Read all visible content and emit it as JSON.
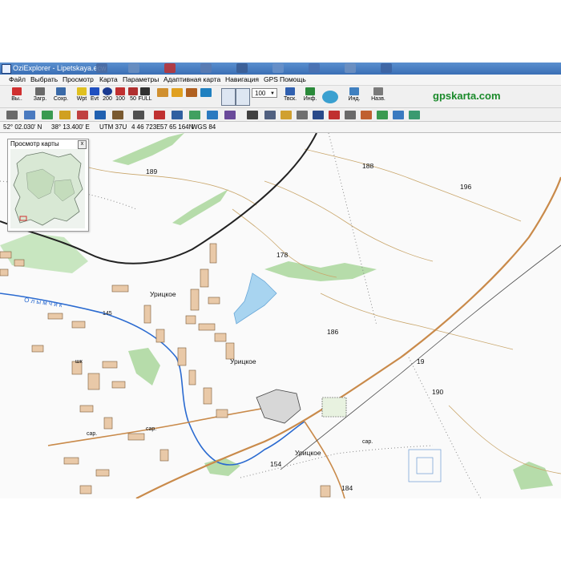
{
  "window": {
    "title": "OziExplorer - Lipetskaya.ecw"
  },
  "menu": [
    "Файл",
    "Выбрать",
    "Просмотр",
    "Карта",
    "Параметры",
    "Адаптивная карта",
    "Навигация",
    "GPS",
    "Помощь"
  ],
  "toolbar": {
    "exit_label": "Вы..",
    "load_label": "Загр.",
    "save_label": "Сохр.",
    "zoom_value": "100",
    "track_label": "Твск.",
    "info_label": "Инф.",
    "ind_label": "Инд.",
    "name_label": "Назв.",
    "zoom_buttons": [
      "Wpt",
      "Evt",
      "200",
      "100",
      "50",
      "FULL"
    ]
  },
  "brand": "gpskarta.com",
  "status": {
    "lat": "52° 02.030' N",
    "lon": "38° 13.400' E",
    "utm": "UTM 37U",
    "easting": "4 46 723E",
    "northing": "57 65 164N",
    "datum": "WGS 84"
  },
  "overview": {
    "title": "Просмотр карты",
    "close": "x"
  },
  "map": {
    "labels": [
      {
        "text": "189",
        "kind": "elev"
      },
      {
        "text": "188",
        "kind": "elev"
      },
      {
        "text": "196",
        "kind": "elev"
      },
      {
        "text": "178",
        "kind": "elev"
      },
      {
        "text": "186",
        "kind": "elev"
      },
      {
        "text": "19",
        "kind": "elev"
      },
      {
        "text": "190",
        "kind": "elev"
      },
      {
        "text": "154",
        "kind": "elev"
      },
      {
        "text": "184",
        "kind": "elev"
      },
      {
        "text": "145",
        "kind": "elev"
      },
      {
        "text": "Урицкое",
        "kind": "place"
      },
      {
        "text": "Урицкое",
        "kind": "place"
      },
      {
        "text": "Урицкое",
        "kind": "place"
      },
      {
        "text": "О л ы м ч и к",
        "kind": "river"
      },
      {
        "text": "сар.",
        "kind": "small"
      },
      {
        "text": "сар.",
        "kind": "small"
      },
      {
        "text": "сар.",
        "kind": "small"
      },
      {
        "text": "шк",
        "kind": "small"
      }
    ]
  },
  "colors": {
    "forest": "#b6dcaa",
    "forest_dark": "#7cc27a",
    "water": "#a8d4f0",
    "river": "#2a6ad0",
    "road": "#c98a4a",
    "rail": "#222222",
    "building": "#e9c9a8"
  }
}
